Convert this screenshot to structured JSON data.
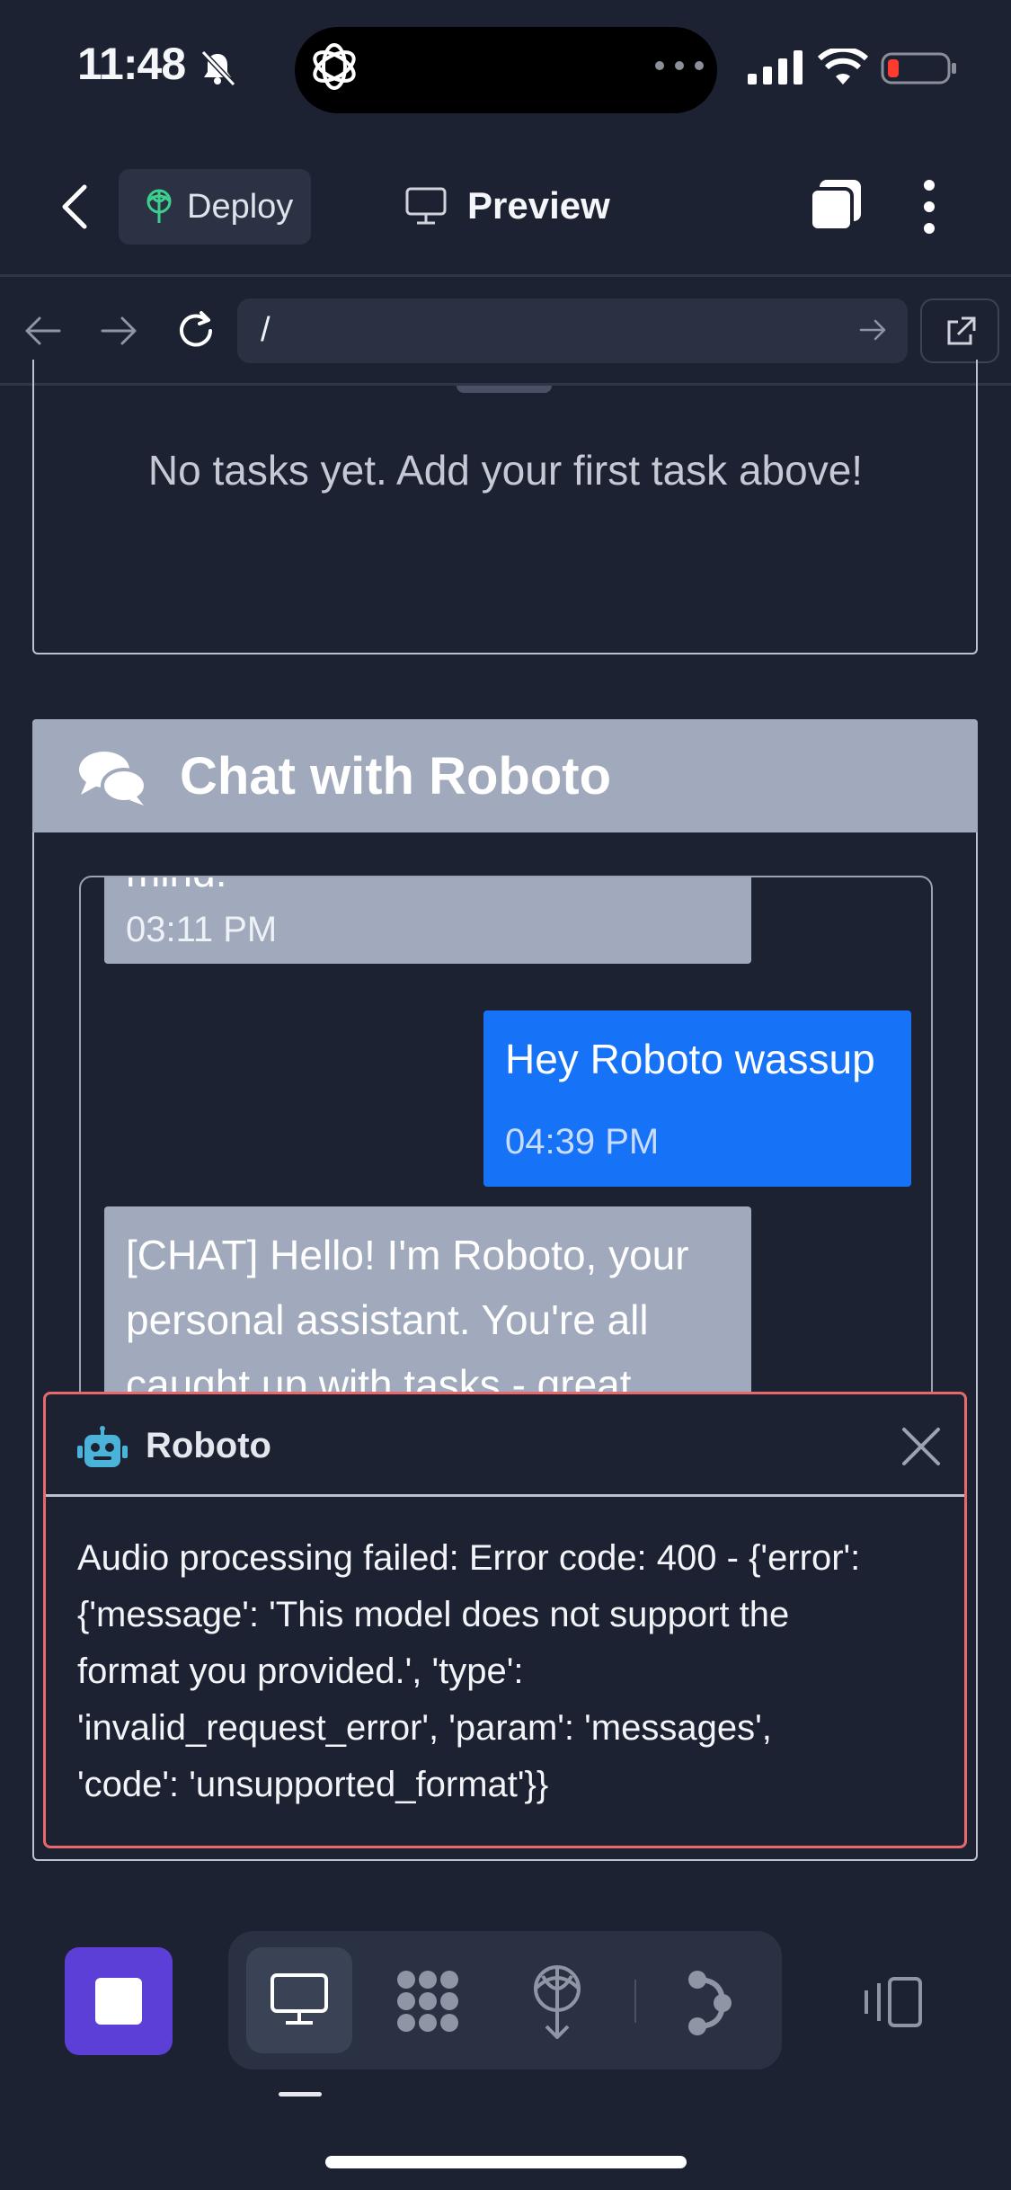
{
  "status_bar": {
    "time": "11:48"
  },
  "app_bar": {
    "deploy_label": "Deploy",
    "preview_label": "Preview"
  },
  "url_bar": {
    "path": "/"
  },
  "tasks": {
    "empty_message": "No tasks yet. Add your first task above!"
  },
  "chat": {
    "title": "Chat with Roboto",
    "messages": [
      {
        "sender": "assistant",
        "text": "mind.",
        "time": "03:11 PM"
      },
      {
        "sender": "user",
        "text": "Hey Roboto wassup",
        "time": "04:39 PM"
      },
      {
        "sender": "assistant",
        "text": "[CHAT] Hello! I'm Roboto, your personal assistant. You're all caught up with tasks - great"
      }
    ]
  },
  "toast": {
    "title": "Roboto",
    "message": "Audio processing failed: Error code: 400 - {'error':\n{'message': 'This model does not support the\nformat you provided.', 'type':\n'invalid_request_error', 'param': 'messages',\n'code': 'unsupported_format'}}"
  },
  "colors": {
    "background": "#1c2232",
    "chat_header": "#a1a9bc",
    "user_bubble": "#1672f7",
    "stop_button": "#5b3fd6",
    "error_border": "#e8686c",
    "robot_icon": "#4bb3d9"
  },
  "icons": {
    "status": [
      "bell-slash-icon",
      "chatgpt-logo-icon",
      "ellipsis-icon",
      "signal-icon",
      "wifi-icon",
      "battery-low-icon"
    ],
    "toolbar": [
      "stop-icon",
      "desktop-icon",
      "apps-icon",
      "deploy-icon",
      "branch-icon",
      "layout-icon"
    ]
  }
}
